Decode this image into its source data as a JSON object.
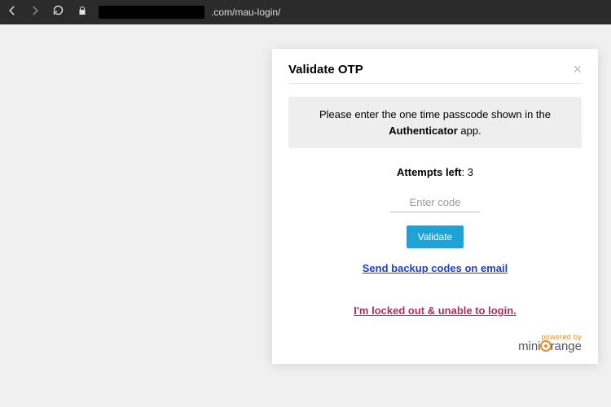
{
  "browser": {
    "url_visible": ".com/mau-login/"
  },
  "dialog": {
    "title": "Validate OTP",
    "info_pre": "Please enter the one time passcode shown in the ",
    "info_strong": "Authenticator",
    "info_post": " app.",
    "attempts_label": "Attempts left",
    "attempts_sep": ": ",
    "attempts_value": "3",
    "otp_placeholder": "Enter code",
    "validate_label": "Validate",
    "backup_link": "Send backup codes on email",
    "lockout_link": "I'm locked out & unable to login.",
    "powered_by": "powered by",
    "brand_pre": "mini",
    "brand_post": "range"
  }
}
